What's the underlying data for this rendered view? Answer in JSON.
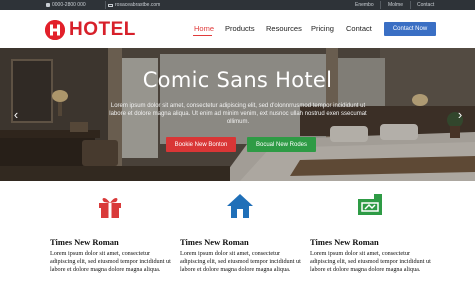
{
  "topbar": {
    "phone": "0000-2800 000",
    "email": "rosaceabrastbe.com",
    "links": [
      "Enembo",
      "Molme",
      "Contact"
    ]
  },
  "header": {
    "logo_letter": "H",
    "logo_text": "HOTEL",
    "nav": [
      "Home",
      "Products",
      "Resources",
      "Pricing",
      "Contact"
    ],
    "active_nav": "Home",
    "cta_label": "Contact Now"
  },
  "hero": {
    "title": "Comic Sans Hotel",
    "text": "Lorem ipsum dolor sit amet, consectetur adipiscing elit, sed d'olonnrrusmod tempor incididunt ut labore et dolore magna aliqua. Ut enim ad minim venim, ext nusnoc ullah nostrud exen ssecumat ollimum.",
    "btn_primary": "Bookie New Bonton",
    "btn_secondary": "Bocual New Rodes",
    "prev_icon": "chevron-left-icon",
    "next_icon": "chevron-right-icon"
  },
  "features": [
    {
      "icon": "gift-icon",
      "title": "Times New Roman",
      "text": "Lorem ipsum dolor sit amet, consectetur adipiscing elit, sed eiusmod tempor incididunt ut labore et dolore magna dolore magna aliqua."
    },
    {
      "icon": "home-icon",
      "title": "Times New Roman",
      "text": "Lorem ipsum dolor sit amet, consectetur adipiscing elit, sed eiusmod tempor incididunt ut labore et dolore magna dolore magna aliqua."
    },
    {
      "icon": "ticket-icon",
      "title": "Times New Roman",
      "text": "Lorem ipsum dolor sit amet, consectetur adipiscing elit, sed eiusmod tempor incididunt ut labore et dolore magna dolore magna aliqua."
    }
  ],
  "colors": {
    "brand_red": "#d7202a",
    "primary_blue": "#3a6fc4",
    "button_red": "#d93636",
    "button_green": "#2e9b45",
    "feature_icon_red": "#d93a3a",
    "feature_icon_blue": "#1f6fb8",
    "feature_icon_green": "#2e9b45",
    "topbar_bg": "#2e3338"
  }
}
